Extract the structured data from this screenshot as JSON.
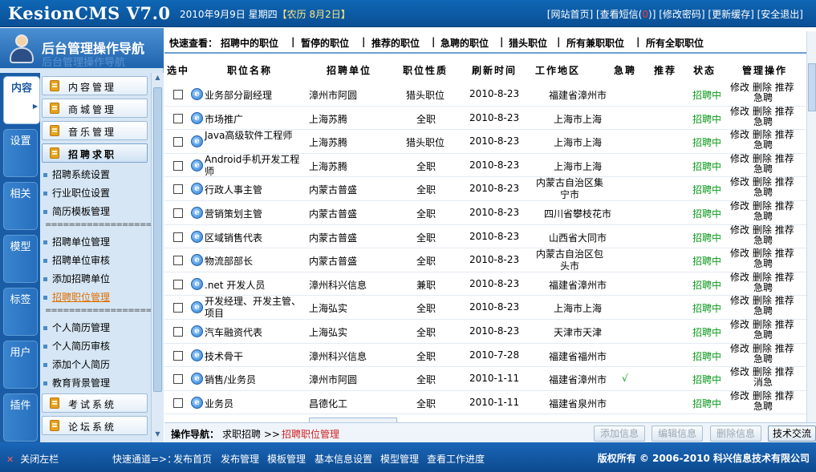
{
  "header": {
    "logo": "KesionCMS V7.0",
    "date": "2010年9月9日 星期四",
    "lunar": "【农历 8月2日】",
    "links": [
      {
        "label": "[网站首页]"
      },
      {
        "label": "[查看短信(",
        "badge": "0",
        "tail": ")]"
      },
      {
        "label": "[修改密码]"
      },
      {
        "label": "[更新缓存]"
      },
      {
        "label": "[安全退出]"
      }
    ]
  },
  "sidebar": {
    "title": "后台管理操作导航",
    "title_ghost": "后台管理操作导航",
    "tabs": [
      "内容",
      "设置",
      "相关",
      "模型",
      "标签",
      "用户",
      "插件"
    ],
    "active_tab": "内容",
    "categories_top": [
      "内容管理",
      "商城管理",
      "音乐管理",
      "招聘求职"
    ],
    "submenu": [
      "招聘系统设置",
      "行业职位设置",
      "简历模板管理",
      "==================",
      "招聘单位管理",
      "招聘单位审核",
      "添加招聘单位",
      "招聘职位管理",
      "==================",
      "个人简历管理",
      "个人简历审核",
      "添加个人简历",
      "教育背景管理"
    ],
    "active_sub": "招聘职位管理",
    "categories_bottom": [
      "考试系统",
      "论坛系统"
    ]
  },
  "quick": {
    "label": "快速查看：",
    "items": [
      "招聘中的职位",
      "暂停的职位",
      "推荐的职位",
      "急聘的职位",
      "猎头职位",
      "所有兼职职位",
      "所有全职职位"
    ],
    "separator": "|"
  },
  "table": {
    "headers": [
      "选中",
      "职位名称",
      "招聘单位",
      "职位性质",
      "刷新时间",
      "工作地区",
      "急聘",
      "推荐",
      "状态",
      "管理操作"
    ],
    "rows": [
      {
        "title": "业务部分副经理",
        "company": "漳州市阿圆",
        "type": "猎头职位",
        "time": "2010-8-23",
        "area": "福建省漳州市",
        "urgent": "",
        "rec": "",
        "status": "招聘中",
        "ops": [
          "修改",
          "删除",
          "推荐",
          "急聘"
        ]
      },
      {
        "title": "市场推广",
        "company": "上海苏腾",
        "type": "全职",
        "time": "2010-8-23",
        "area": "上海市上海",
        "urgent": "",
        "rec": "",
        "status": "招聘中",
        "ops": [
          "修改",
          "删除",
          "推荐",
          "急聘"
        ]
      },
      {
        "title": "Java高级软件工程师",
        "company": "上海苏腾",
        "type": "猎头职位",
        "time": "2010-8-23",
        "area": "上海市上海",
        "urgent": "",
        "rec": "",
        "status": "招聘中",
        "ops": [
          "修改",
          "删除",
          "推荐",
          "急聘"
        ]
      },
      {
        "title": "Android手机开发工程师",
        "company": "上海苏腾",
        "type": "全职",
        "time": "2010-8-23",
        "area": "上海市上海",
        "urgent": "",
        "rec": "",
        "status": "招聘中",
        "ops": [
          "修改",
          "删除",
          "推荐",
          "急聘"
        ]
      },
      {
        "title": "行政人事主管",
        "company": "内蒙古普盛",
        "type": "全职",
        "time": "2010-8-23",
        "area": "内蒙古自治区集宁市",
        "urgent": "",
        "rec": "",
        "status": "招聘中",
        "ops": [
          "修改",
          "删除",
          "推荐",
          "急聘"
        ]
      },
      {
        "title": "营销策划主管",
        "company": "内蒙古普盛",
        "type": "全职",
        "time": "2010-8-23",
        "area": "四川省攀枝花市",
        "urgent": "",
        "rec": "",
        "status": "招聘中",
        "ops": [
          "修改",
          "删除",
          "推荐",
          "急聘"
        ]
      },
      {
        "title": "区域销售代表",
        "company": "内蒙古普盛",
        "type": "全职",
        "time": "2010-8-23",
        "area": "山西省大同市",
        "urgent": "",
        "rec": "",
        "status": "招聘中",
        "ops": [
          "修改",
          "删除",
          "推荐",
          "急聘"
        ]
      },
      {
        "title": "物流部部长",
        "company": "内蒙古普盛",
        "type": "全职",
        "time": "2010-8-23",
        "area": "内蒙古自治区包头市",
        "urgent": "",
        "rec": "",
        "status": "招聘中",
        "ops": [
          "修改",
          "删除",
          "推荐",
          "急聘"
        ]
      },
      {
        "title": ".net 开发人员",
        "company": "漳州科兴信息",
        "type": "兼职",
        "time": "2010-8-23",
        "area": "福建省漳州市",
        "urgent": "",
        "rec": "",
        "status": "招聘中",
        "ops": [
          "修改",
          "删除",
          "推荐",
          "急聘"
        ]
      },
      {
        "title": "开发经理、开发主管、项目",
        "company": "上海弘实",
        "type": "全职",
        "time": "2010-8-23",
        "area": "上海市上海",
        "urgent": "",
        "rec": "",
        "status": "招聘中",
        "ops": [
          "修改",
          "删除",
          "推荐",
          "急聘"
        ]
      },
      {
        "title": "汽车融资代表",
        "company": "上海弘实",
        "type": "全职",
        "time": "2010-8-23",
        "area": "天津市天津",
        "urgent": "",
        "rec": "",
        "status": "招聘中",
        "ops": [
          "修改",
          "删除",
          "推荐",
          "急聘"
        ]
      },
      {
        "title": "技术骨干",
        "company": "漳州科兴信息",
        "type": "全职",
        "time": "2010-7-28",
        "area": "福建省福州市",
        "urgent": "",
        "rec": "",
        "status": "招聘中",
        "ops": [
          "修改",
          "删除",
          "推荐",
          "急聘"
        ]
      },
      {
        "title": "销售/业务员",
        "company": "漳州市阿圆",
        "type": "全职",
        "time": "2010-1-11",
        "area": "福建省漳州市",
        "urgent": "√",
        "rec": "",
        "status": "招聘中",
        "ops": [
          "修改",
          "删除",
          "推荐",
          "消急"
        ]
      },
      {
        "title": "业务员",
        "company": "昌德化工",
        "type": "全职",
        "time": "2010-1-11",
        "area": "福建省泉州市",
        "urgent": "",
        "rec": "",
        "status": "招聘中",
        "ops": [
          "修改",
          "删除",
          "推荐",
          "急聘"
        ]
      }
    ]
  },
  "navbar": {
    "label": "操作导航：",
    "crumb": "求职招聘 >>",
    "current": "招聘职位管理",
    "buttons": [
      "添加信息",
      "编辑信息",
      "删除信息",
      "技术交流"
    ]
  },
  "footer": {
    "close": "关闭左栏",
    "quick_label": "快速通道=>：",
    "links": [
      "发布首页",
      "发布管理",
      "模板管理",
      "基本信息设置",
      "模型管理",
      "查看工作进度"
    ],
    "copyright": "版权所有 © 2006-2010 科兴信息技术有限公司"
  },
  "colors": {
    "header_blue": "#0f67b5",
    "status_green": "#0a9a1a",
    "active_orange": "#e07000"
  }
}
